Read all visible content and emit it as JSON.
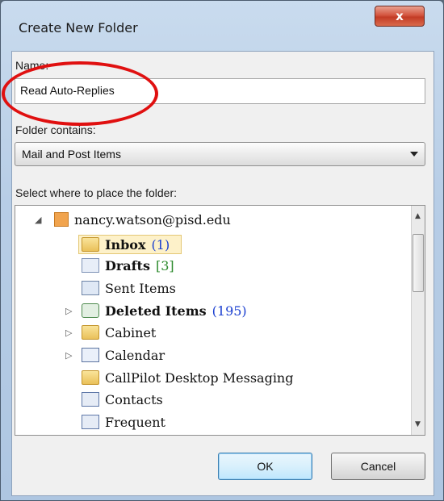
{
  "window": {
    "title": "Create New Folder",
    "close_label": "x"
  },
  "name_field": {
    "label": "Name:",
    "value": "Read Auto-Replies"
  },
  "contains": {
    "label": "Folder contains:",
    "value": "Mail and Post Items"
  },
  "tree_label": "Select where to place the folder:",
  "tree": {
    "account": "nancy.watson@pisd.edu",
    "items": [
      {
        "label": "Inbox",
        "count": "(1)"
      },
      {
        "label": "Drafts",
        "count": "[3]"
      },
      {
        "label": "Sent Items"
      },
      {
        "label": "Deleted Items",
        "count": "(195)"
      },
      {
        "label": "Cabinet"
      },
      {
        "label": "Calendar"
      },
      {
        "label": "CallPilot Desktop Messaging"
      },
      {
        "label": "Contacts"
      },
      {
        "label": "Frequent"
      }
    ]
  },
  "buttons": {
    "ok": "OK",
    "cancel": "Cancel"
  },
  "annotation": {
    "color": "#e01010"
  }
}
